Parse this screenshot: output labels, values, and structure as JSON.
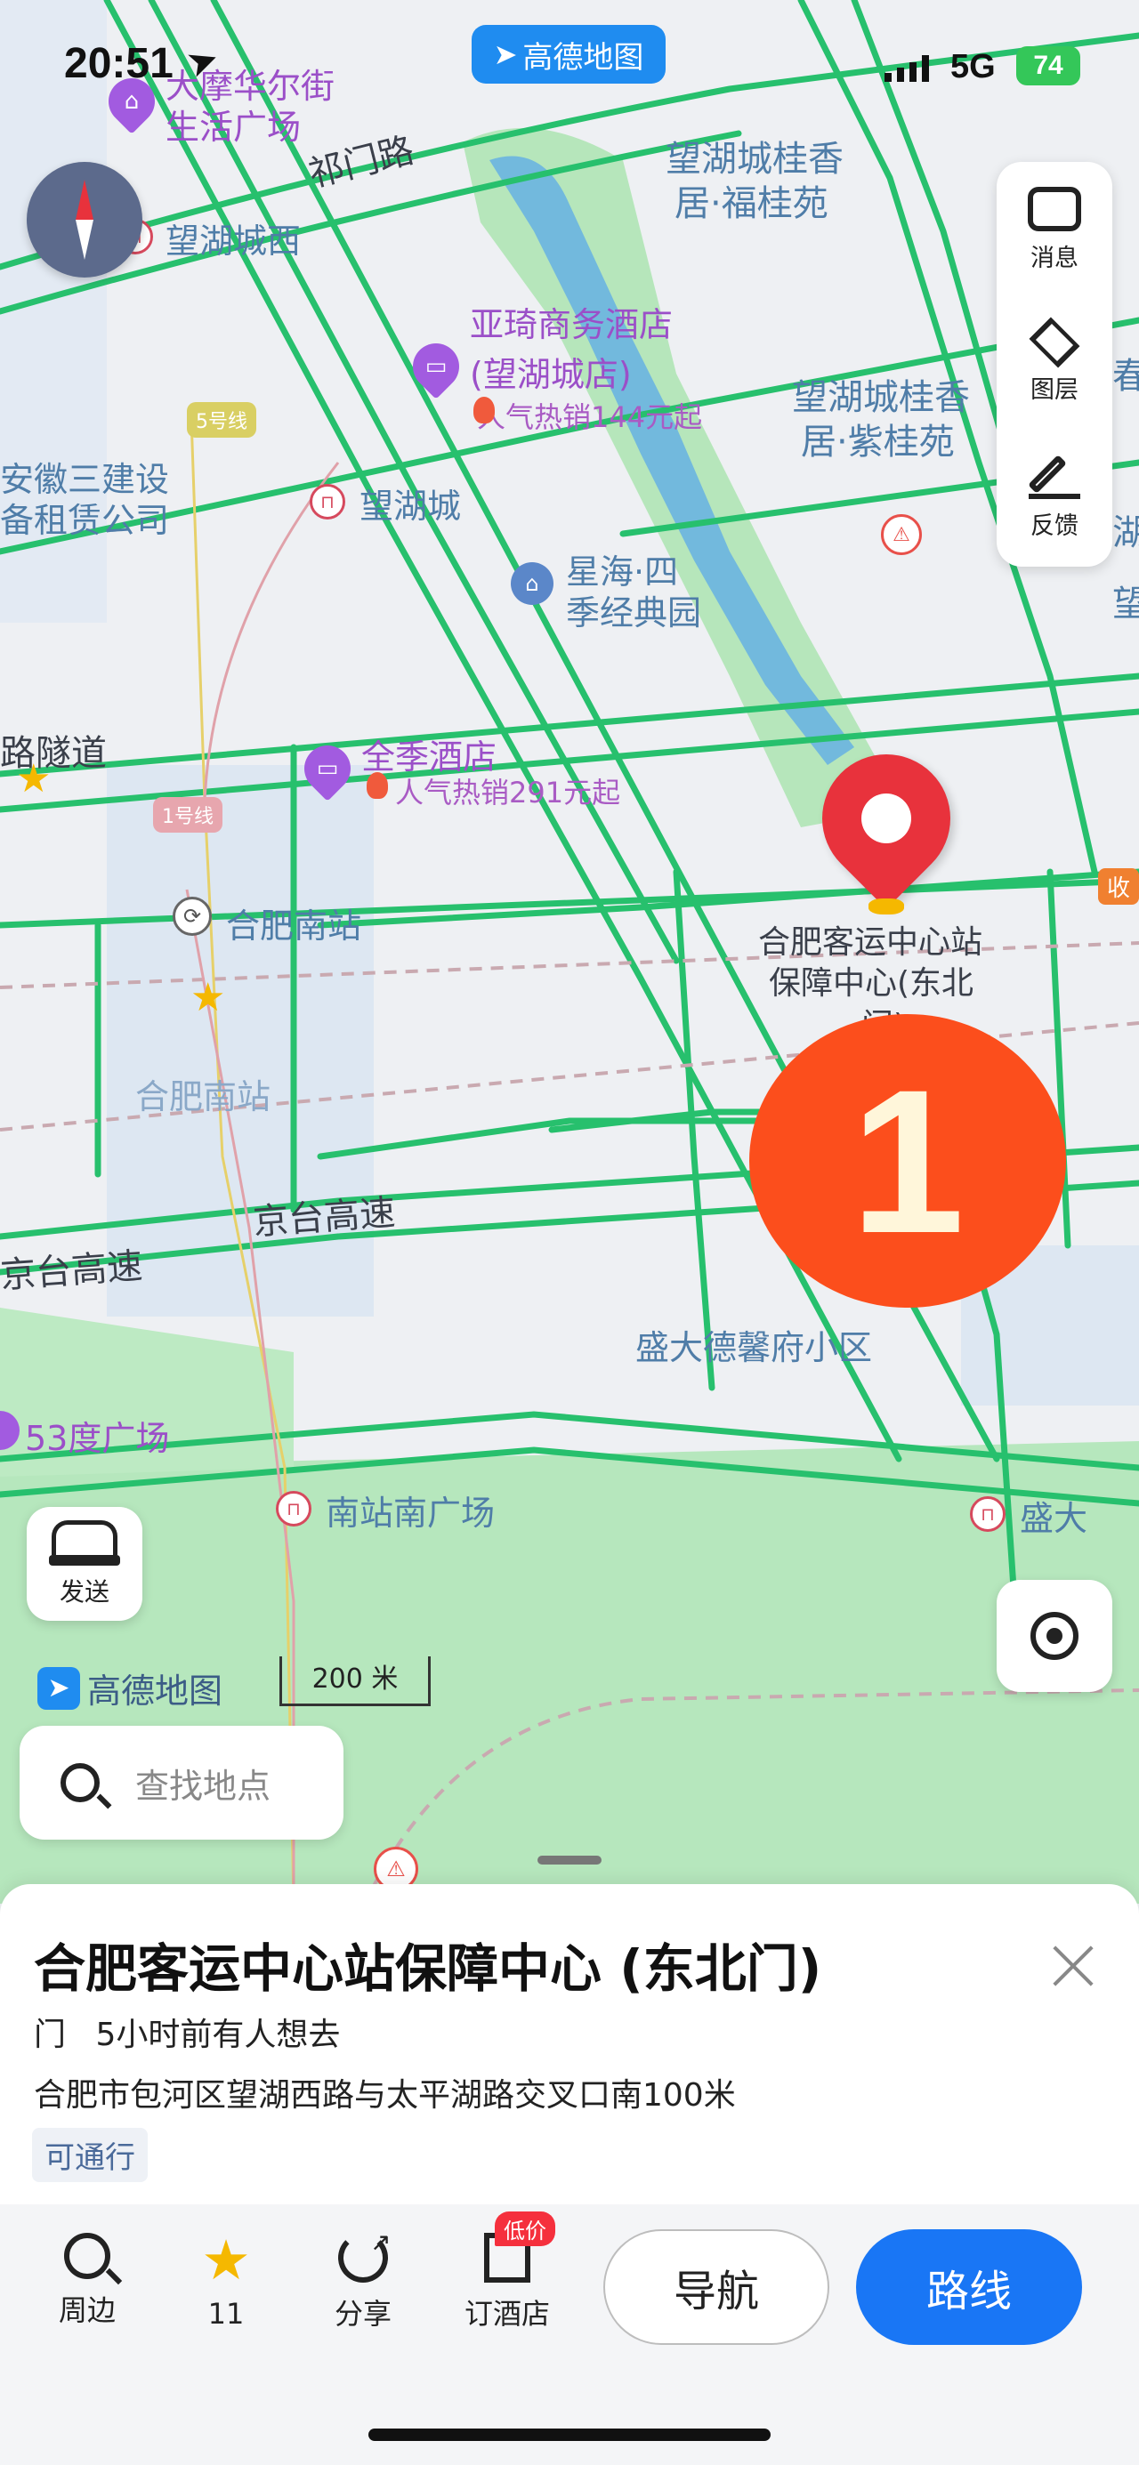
{
  "status_bar": {
    "time": "20:51",
    "network": "5G",
    "battery": "74"
  },
  "app_badge": {
    "label": "高德地图"
  },
  "map": {
    "labels": {
      "dapu": "大摩华尔街",
      "dapu2": "生活广场",
      "qimen": "祁门路",
      "wanghu_gui1": "望湖城桂香",
      "wanghu_gui2": "居·福桂苑",
      "wanghu_west": "望湖城西",
      "yaqi1": "亚琦商务酒店",
      "yaqi2": "(望湖城店)",
      "yaqi_promo": "人气热销144元起",
      "line5": "5号线",
      "anhui1": "安徽三建设",
      "anhui2": "备租赁公司",
      "wanghu_zi1": "望湖城桂香",
      "wanghu_zi2": "居·紫桂苑",
      "wanghucheng": "望湖城",
      "xinghai1": "星海·四",
      "xinghai2": "季经典园",
      "tunnel": "路隧道",
      "quanji": "全季酒店",
      "quanji_promo": "人气热销291元起",
      "line1": "1号线",
      "hefei_south": "合肥南站",
      "hefei_south2": "合肥南站",
      "dest1": "合肥客运中心站",
      "dest2": "保障中心(东北",
      "dest3": "门)",
      "jingtai1": "京台高速",
      "jingtai2": "京台高速",
      "shengda_xf": "盛大德馨府小区",
      "deg53": "53度广场",
      "south_square": "南站南广场",
      "shengda": "盛大",
      "right_partial1": "春",
      "right_partial2": "湖",
      "right_partial3": "望",
      "shou": "收",
      "scale": "200 米",
      "logo": "高德地图"
    },
    "marker_number": "1",
    "send_label": "发送"
  },
  "right_panel": {
    "items": [
      {
        "icon": "message-icon",
        "label": "消息"
      },
      {
        "icon": "layers-icon",
        "label": "图层"
      },
      {
        "icon": "feedback-icon",
        "label": "反馈"
      }
    ]
  },
  "search": {
    "placeholder": "查找地点"
  },
  "place_card": {
    "title": "合肥客运中心站保障中心 (东北门)",
    "category": "门",
    "popularity": "5小时前有人想去",
    "address": "合肥市包河区望湖西路与太平湖路交叉口南100米",
    "tag": "可通行"
  },
  "bottom_bar": {
    "nearby": "周边",
    "favorites": "11",
    "share": "分享",
    "hotel": "订酒店",
    "hotel_badge": "低价",
    "navigate": "导航",
    "route": "路线"
  },
  "colors": {
    "road_green": "#27c06d",
    "park_green": "#a9e3b3",
    "water_blue": "#5ba9e8",
    "marker_red": "#e8323c",
    "badge_orange": "#fc4e1c",
    "route_button": "#1976f5"
  }
}
